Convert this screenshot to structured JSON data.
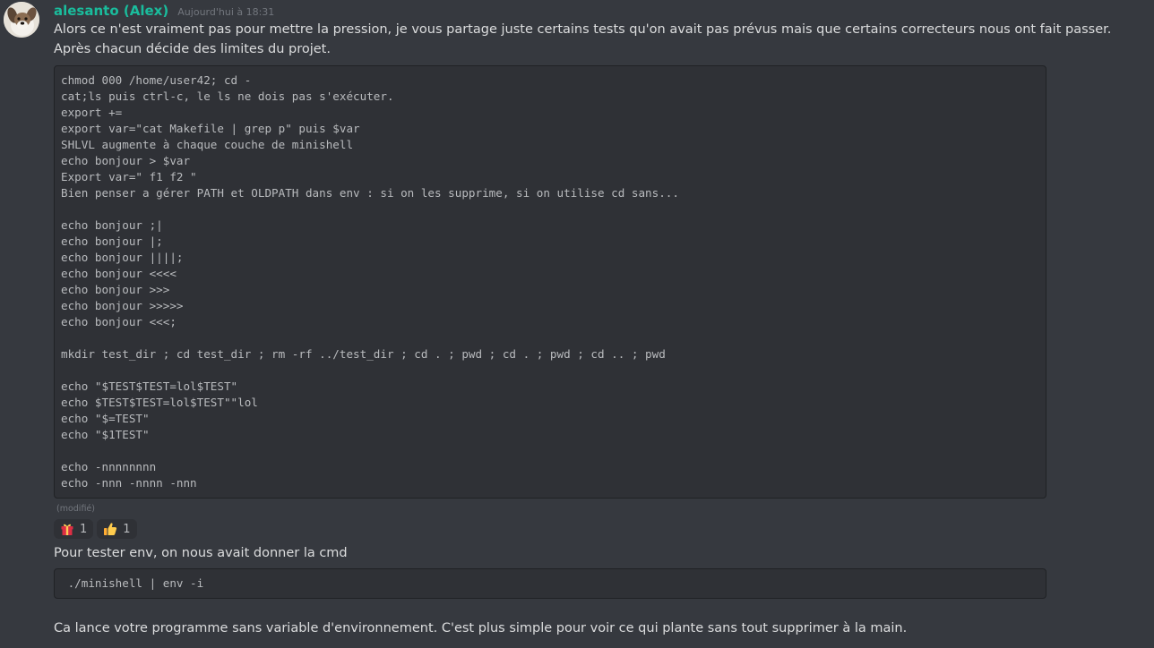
{
  "author": {
    "name": "alesanto (Alex)",
    "timestamp": "Aujourd'hui à 18:31",
    "color": "#1abc9c",
    "avatar_icon": "avatar-dog-icon"
  },
  "messages": [
    {
      "text": "Alors ce n'est vraiment pas pour mettre la pression, je vous partage juste certains tests qu'on avait pas prévus mais que certains correcteurs nous ont fait passer. Après chacun décide des limites du projet.",
      "code": [
        "chmod 000 /home/user42; cd -",
        "cat;ls puis ctrl-c, le ls ne dois pas s'exécuter.",
        "export +=",
        "export var=\"cat Makefile | grep p\" puis $var",
        "SHLVL augmente à chaque couche de minishell",
        "echo bonjour > $var",
        "Export var=\" f1 f2 \"",
        "Bien penser a gérer PATH et OLDPATH dans env : si on les supprime, si on utilise cd sans...",
        "",
        "echo bonjour ;|",
        "echo bonjour |;",
        "echo bonjour ||||;",
        "echo bonjour <<<<",
        "echo bonjour >>>",
        "echo bonjour >>>>>",
        "echo bonjour <<<;",
        "",
        "mkdir test_dir ; cd test_dir ; rm -rf ../test_dir ; cd . ; pwd ; cd . ; pwd ; cd .. ; pwd",
        "",
        "echo \"$TEST$TEST=lol$TEST\"",
        "echo $TEST$TEST=lol$TEST\"\"lol",
        "echo \"$=TEST\"",
        "echo \"$1TEST\"",
        "",
        "echo -nnnnnnnn",
        "echo -nnn -nnnn -nnn"
      ],
      "edited_label": "(modifié)",
      "reactions": [
        {
          "emoji": "gift-icon",
          "count": "1"
        },
        {
          "emoji": "thumbs-up-icon",
          "count": "1"
        }
      ]
    },
    {
      "text": "Pour tester env, on nous avait donner la cmd",
      "code": [
        " ./minishell | env -i"
      ]
    },
    {
      "text": "Ca lance votre programme sans variable d'environnement. C'est plus simple pour voir ce qui plante sans tout supprimer à la main."
    }
  ]
}
